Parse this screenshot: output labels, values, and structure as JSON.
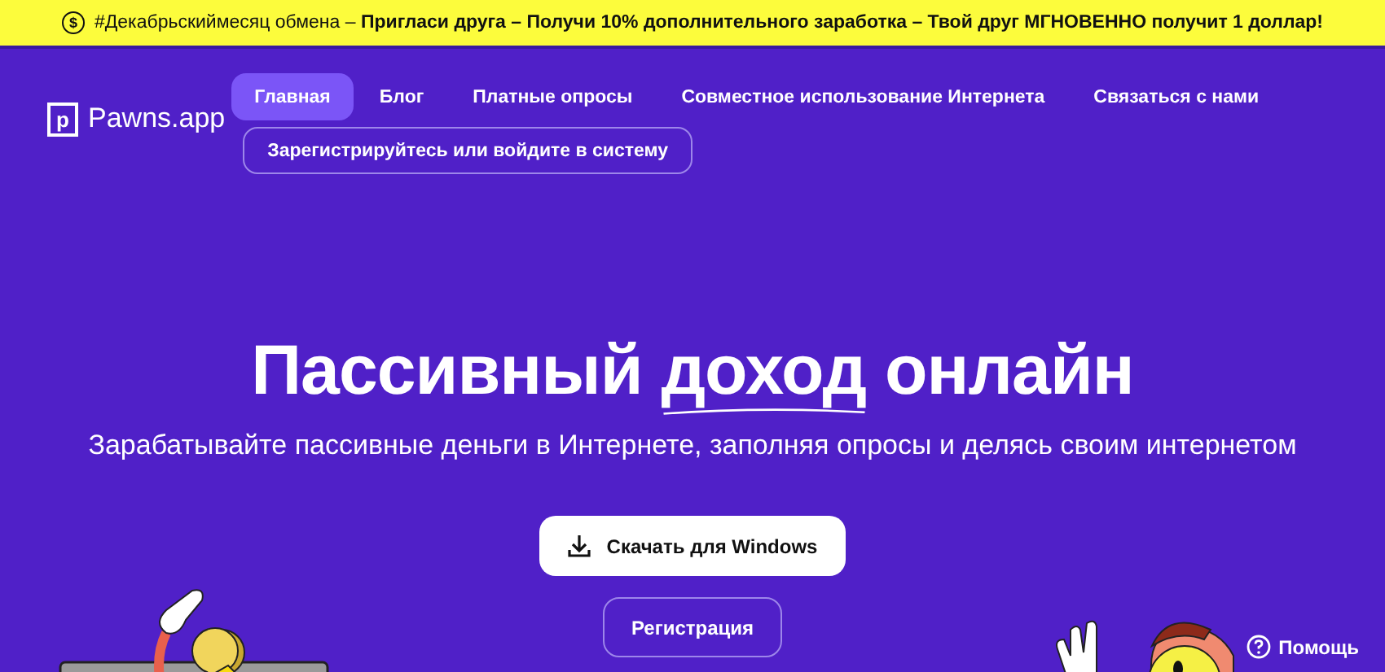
{
  "banner": {
    "icon": "$",
    "text": "#Декабрьскиймесяц обмена – **Пригласи друга – Получи 10% дополнительного заработка – Твой друг МГНОВЕННО получит 1 доллар!**"
  },
  "logo": {
    "icon": "p",
    "text": "Pawns.app"
  },
  "nav": [
    {
      "label": "Главная",
      "selected": true
    },
    {
      "label": "Блог",
      "selected": false
    },
    {
      "label": "Платные опросы",
      "selected": false
    },
    {
      "label": "Совместное использование Интернета",
      "selected": false
    },
    {
      "label": "Связаться с нами",
      "selected": false
    }
  ],
  "login_button": "Зарегистрируйтесь или войдите в систему",
  "hero": {
    "title_parts": [
      {
        "text": "Пассивный ",
        "underlined": false
      },
      {
        "text": "доход",
        "underlined": true
      },
      {
        "text": " онлайн",
        "underlined": false
      }
    ],
    "subtitle": "Зарабатывайте пассивные деньги в Интернете, заполняя опросы и делясь своим интернетом",
    "download_button": "Скачать для Windows",
    "register_button": "Регистрация"
  },
  "help_button": "Помощь"
}
